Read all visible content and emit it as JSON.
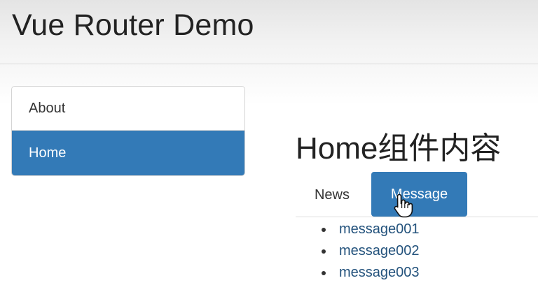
{
  "header": {
    "title": "Vue Router Demo"
  },
  "sidebar": {
    "items": [
      {
        "label": "About",
        "active": false
      },
      {
        "label": "Home",
        "active": true
      }
    ]
  },
  "main": {
    "title": "Home组件内容",
    "tabs": [
      {
        "label": "News",
        "active": false
      },
      {
        "label": "Message",
        "active": true
      }
    ],
    "messages": [
      "message001",
      "message002",
      "message003"
    ]
  },
  "colors": {
    "accent": "#337ab7",
    "link": "#23527c"
  },
  "cursor": {
    "icon": "hand-pointer-icon"
  }
}
